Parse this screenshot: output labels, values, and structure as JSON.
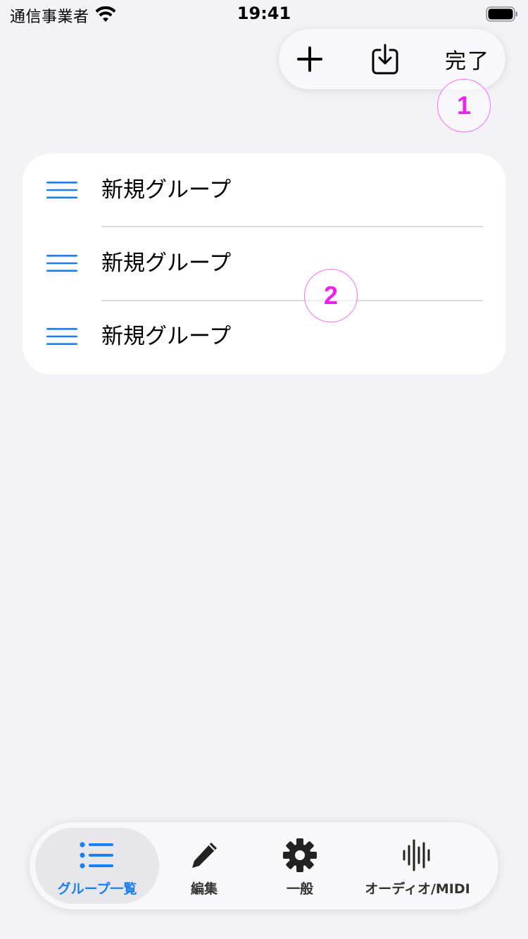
{
  "status_bar": {
    "carrier": "通信事業者",
    "time": "19:41",
    "wifi_icon": "wifi-icon",
    "battery_icon": "battery-full-icon"
  },
  "toolbar": {
    "add_icon": "plus-icon",
    "import_icon": "tray-arrow-down-icon",
    "done_label": "完了"
  },
  "annotations": {
    "marker_1": "1",
    "marker_2": "2"
  },
  "groups": {
    "handle_icon": "reorder-handle-icon",
    "items": [
      {
        "label": "新規グループ"
      },
      {
        "label": "新規グループ"
      },
      {
        "label": "新規グループ"
      }
    ]
  },
  "tab_bar": {
    "selected": "groups",
    "tabs": [
      {
        "id": "groups",
        "label": "グループ一覧",
        "icon": "list-bullet-icon"
      },
      {
        "id": "edit",
        "label": "編集",
        "icon": "pencil-icon"
      },
      {
        "id": "general",
        "label": "一般",
        "icon": "gear-icon"
      },
      {
        "id": "audio",
        "label": "オーディオ/MIDI",
        "icon": "waveform-icon"
      }
    ]
  },
  "colors": {
    "accent": "#1a7ff0",
    "background": "#f2f2f7",
    "card": "#ffffff",
    "annotation": "#ee22ee"
  }
}
